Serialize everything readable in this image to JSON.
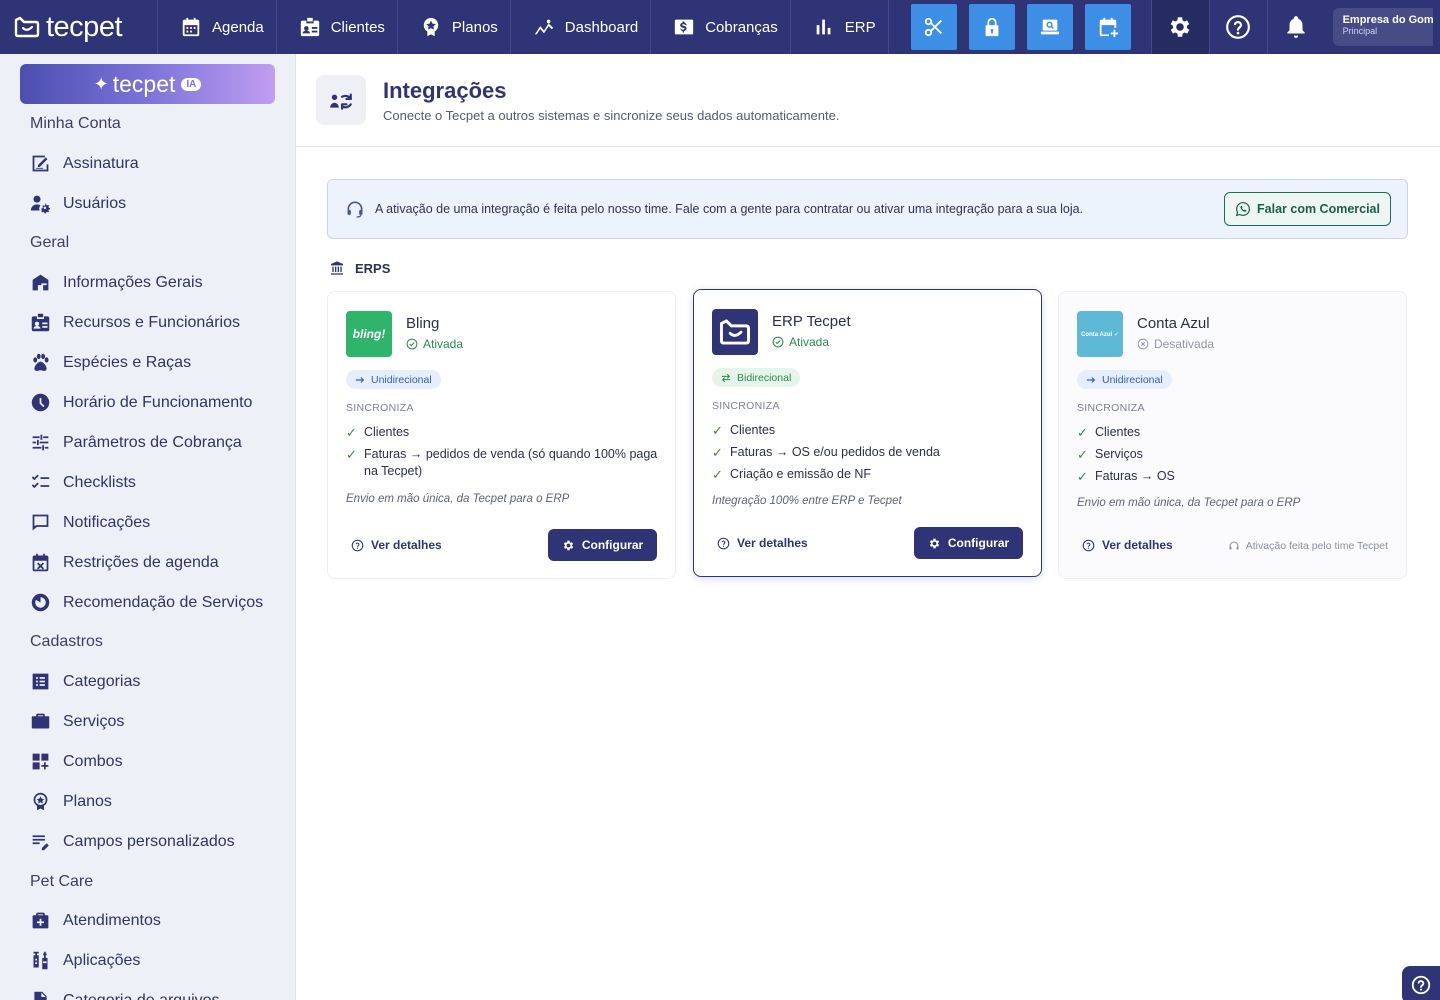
{
  "brand": {
    "logo_text": "tecpet"
  },
  "topnav": {
    "items": [
      {
        "label": "Agenda",
        "icon": "calendar-icon"
      },
      {
        "label": "Clientes",
        "icon": "id-card-icon"
      },
      {
        "label": "Planos",
        "icon": "medal-icon"
      },
      {
        "label": "Dashboard",
        "icon": "chart-line-icon"
      },
      {
        "label": "Cobranças",
        "icon": "dollar-icon"
      },
      {
        "label": "ERP",
        "icon": "bar-chart-icon"
      }
    ],
    "company": {
      "name": "Empresa do Gomes",
      "unit": "Principal"
    },
    "accent": "#3d8fe6"
  },
  "sidebar": {
    "ia": {
      "text": "tecpet",
      "badge": "IA"
    },
    "sections": {
      "minha_conta": "Minha Conta",
      "geral": "Geral",
      "cadastros": "Cadastros",
      "pet_care": "Pet Care"
    },
    "items": {
      "assinatura": "Assinatura",
      "usuarios": "Usuários",
      "informacoes": "Informações Gerais",
      "recursos": "Recursos e Funcionários",
      "especies": "Espécies e Raças",
      "horario": "Horário de Funcionamento",
      "parametros": "Parâmetros de Cobrança",
      "checklists": "Checklists",
      "notificacoes": "Notificações",
      "restricoes": "Restrições de agenda",
      "recomendacao": "Recomendação de Serviços",
      "categorias": "Categorias",
      "servicos": "Serviços",
      "combos": "Combos",
      "planos": "Planos",
      "campos": "Campos personalizados",
      "atendimentos": "Atendimentos",
      "aplicacoes": "Aplicações",
      "categoria_arquivos": "Categoria de arquivos"
    }
  },
  "page": {
    "title": "Integrações",
    "subtitle": "Conecte o Tecpet a outros sistemas e sincronize seus dados automaticamente.",
    "banner": {
      "text": "A ativação de uma integração é feita pelo nosso time. Fale com a gente para contratar ou ativar uma integração para a sua loja.",
      "button": "Falar com Comercial"
    },
    "section_label": "ERPS",
    "sync_title": "SINCRONIZA",
    "details_label": "Ver detalhes",
    "configure_label": "Configurar"
  },
  "cards": [
    {
      "name": "Bling",
      "logo_text": "bling!",
      "logo_color": "#2fb46c",
      "status": "Ativada",
      "direction": "Unidirecional",
      "sync": [
        "Clientes",
        "Faturas → pedidos de venda (só quando 100% paga na Tecpet)"
      ],
      "note": "Envio em mão única, da Tecpet para o ERP"
    },
    {
      "name": "ERP Tecpet",
      "logo_color": "#2e3475",
      "status": "Ativada",
      "direction": "Bidirecional",
      "sync": [
        "Clientes",
        "Faturas → OS e/ou pedidos de venda",
        "Criação e emissão de NF"
      ],
      "note": "Integração 100% entre ERP e Tecpet"
    },
    {
      "name": "Conta Azul",
      "logo_text": "Conta Azul ✓",
      "logo_color": "#5db9d6",
      "status": "Desativada",
      "direction": "Unidirecional",
      "sync": [
        "Clientes",
        "Serviços",
        "Faturas → OS"
      ],
      "note": "Envio em mão única, da Tecpet para o ERP",
      "activation_note": "Ativação feita pelo time Tecpet"
    }
  ]
}
